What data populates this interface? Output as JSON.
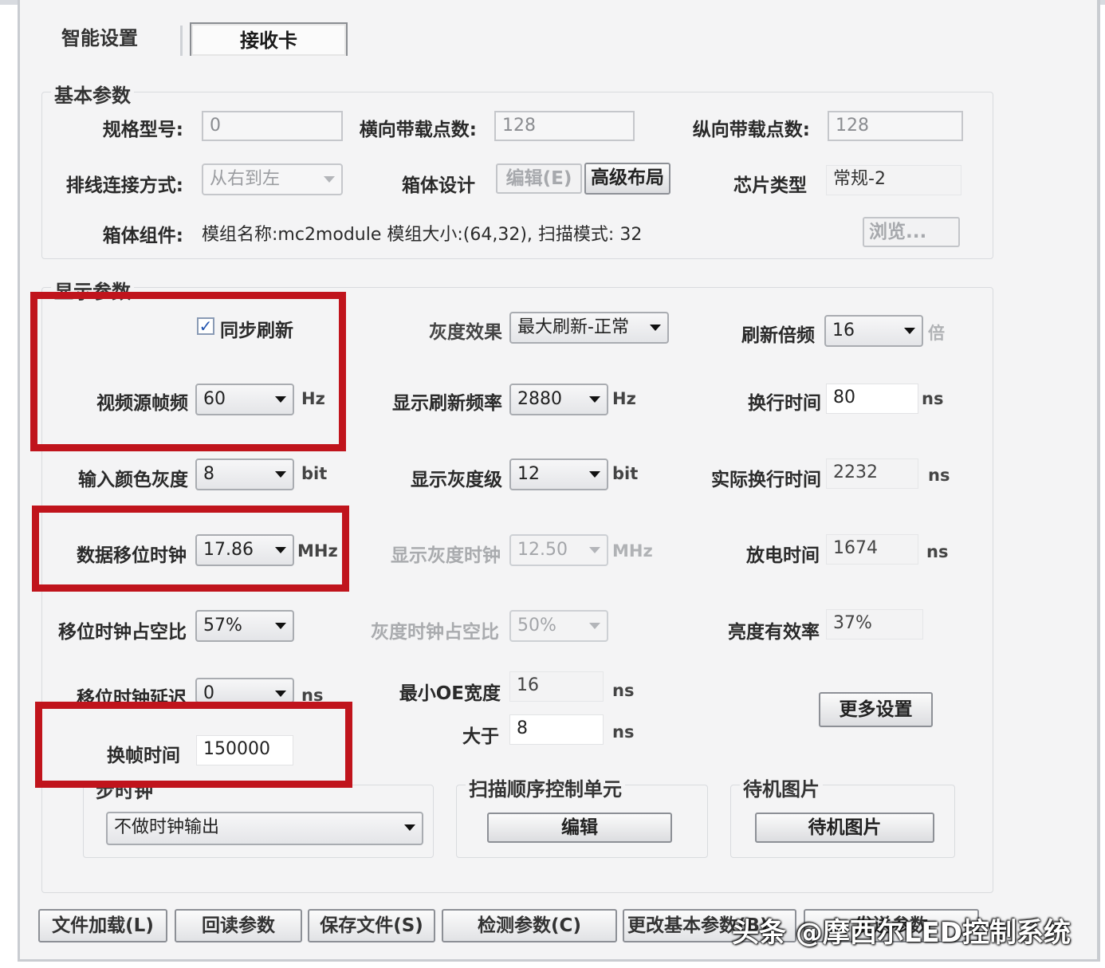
{
  "tabs": {
    "smart": "智能设置",
    "receiver": "接收卡"
  },
  "basic": {
    "title": "基本参数",
    "spec_label": "规格型号:",
    "spec_value": "0",
    "hpix_label": "横向带载点数:",
    "hpix_value": "128",
    "vpix_label": "纵向带载点数:",
    "vpix_value": "128",
    "wiring_label": "排线连接方式:",
    "wiring_value": "从右到左",
    "cabinet_label": "箱体设计",
    "edit_btn": "编辑(E)",
    "layout_btn": "高级布局",
    "chip_label": "芯片类型",
    "chip_value": "常规-2",
    "component_label": "箱体组件:",
    "component_value": "模组名称:mc2module 模组大小:(64,32), 扫描模式: 32",
    "browse_btn": "浏览..."
  },
  "display": {
    "title": "显示参数",
    "sync_refresh": "同步刷新",
    "sync_checked": "✓",
    "video_fps_label": "视频源帧频",
    "video_fps_value": "60",
    "video_fps_unit": "Hz",
    "gray_effect_label": "灰度效果",
    "gray_effect_value": "最大刷新-正常",
    "refresh_mult_label": "刷新倍频",
    "refresh_mult_value": "16",
    "refresh_mult_unit": "倍",
    "disp_refresh_label": "显示刷新频率",
    "disp_refresh_value": "2880",
    "disp_refresh_unit": "Hz",
    "line_time_label": "换行时间",
    "line_time_value": "80",
    "line_time_unit": "ns",
    "input_gray_label": "输入颜色灰度",
    "input_gray_value": "8",
    "input_gray_unit": "bit",
    "disp_gray_label": "显示灰度级",
    "disp_gray_value": "12",
    "disp_gray_unit": "bit",
    "actual_line_label": "实际换行时间",
    "actual_line_value": "2232",
    "actual_line_unit": "ns",
    "shift_clock_label": "数据移位时钟",
    "shift_clock_value": "17.86",
    "shift_clock_unit": "MHz",
    "gray_clock_label": "显示灰度时钟",
    "gray_clock_value": "12.50",
    "gray_clock_unit": "MHz",
    "discharge_label": "放电时间",
    "discharge_value": "1674",
    "discharge_unit": "ns",
    "shift_duty_label": "移位时钟占空比",
    "shift_duty_value": "57%",
    "gray_duty_label": "灰度时钟占空比",
    "gray_duty_value": "50%",
    "brightness_label": "亮度有效率",
    "brightness_value": "37%",
    "shift_delay_label": "移位时钟延迟",
    "shift_delay_value": "0",
    "shift_delay_unit": "ns",
    "min_oe_label": "最小OE宽度",
    "min_oe_value": "16",
    "min_oe_unit": "ns",
    "greater_label": "大于",
    "greater_value": "8",
    "greater_unit": "ns",
    "more_btn": "更多设置",
    "frame_time_label": "换帧时间",
    "frame_time_value": "150000"
  },
  "sync_clock": {
    "title": "步时钟",
    "value": "不做时钟输出"
  },
  "scan_unit": {
    "title": "扫描顺序控制单元",
    "edit_btn": "编辑"
  },
  "standby": {
    "title": "待机图片",
    "btn": "待机图片"
  },
  "bottom": [
    "文件加载(L)",
    "回读参数",
    "保存文件(S)",
    "检测参数(C)",
    "更改基本参数(B)",
    "发送参数"
  ],
  "watermark": "头条 @摩西尔LED控制系统",
  "colors": {
    "highlight": "#c0141c"
  }
}
